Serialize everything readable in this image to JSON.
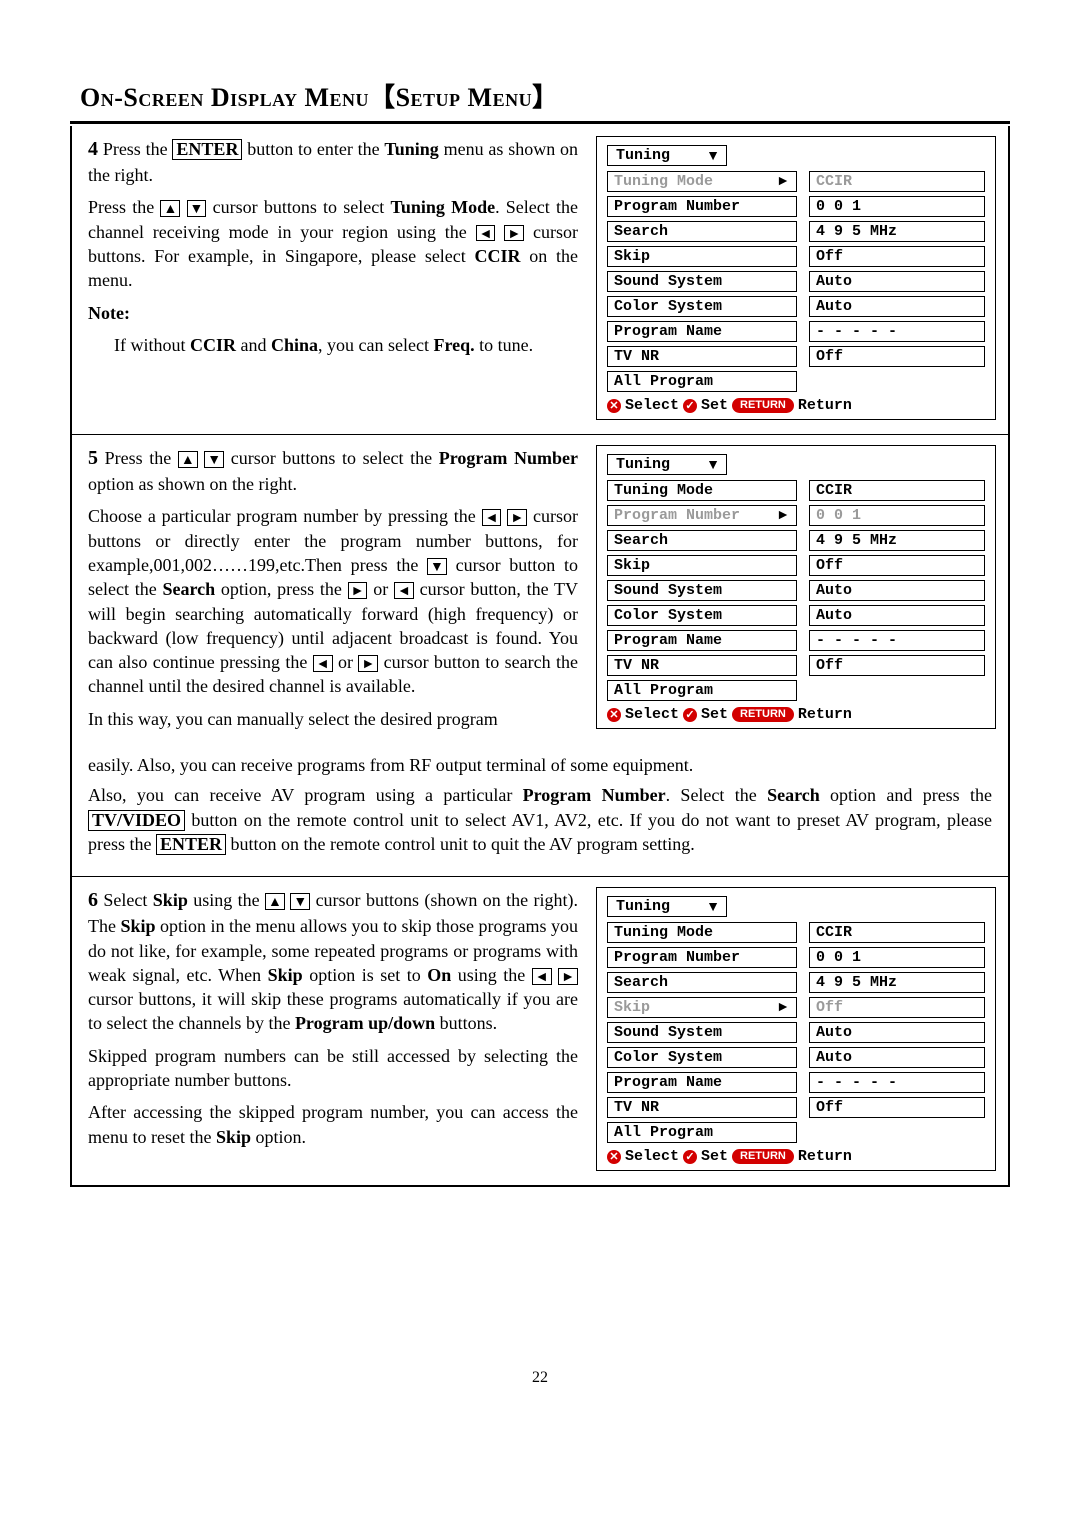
{
  "title": {
    "part1": "On-Screen Display Menu",
    "bracket_open": "【",
    "part2": "Setup Menu",
    "bracket_close": "】"
  },
  "page_number": "22",
  "steps": {
    "s4": {
      "num": "4",
      "p1a": "Press the ",
      "enter": "ENTER",
      "p1b": " button to enter the ",
      "tuning_b": "Tuning",
      "p1c": " menu as shown on the right.",
      "p2a": "Press the ",
      "p2b": " cursor buttons to select ",
      "tm_b": "Tuning Mode",
      "p2c": ". Select the channel receiving mode in your region using the ",
      "p2d": " cursor buttons. For example, in Singapore, please select ",
      "ccir_b": "CCIR",
      "p2e": " on the menu.",
      "note_hd": "Note:",
      "note_a": "If without ",
      "note_ccir": "CCIR",
      "note_b": " and ",
      "note_china": "China",
      "note_c": ", you can select ",
      "note_freq": "Freq.",
      "note_d": " to tune."
    },
    "s5": {
      "num": "5",
      "p1a": "Press the ",
      "p1b": " cursor buttons to select the ",
      "pn_b": "Program Number",
      "p1c": " option as shown on the right.",
      "p2a": "Choose a particular program number by pressing the ",
      "p2b": " cursor buttons or directly enter the program number buttons, for example,001,002……199,etc.Then press the ",
      "p2c": " cursor button to select the ",
      "search_b": "Search",
      "p2d": " option, press the ",
      "p2e": " or ",
      "p2f": " cursor button, the TV will begin searching automatically forward (high frequency) or backward (low frequency) until adjacent broadcast is found. You can also continue pressing the ",
      "p2g": " or ",
      "p2h": " cursor button to search the channel until the desired channel is available.",
      "p3": "In this way, you can manually select the desired program",
      "p4a": "easily. Also, you can receive programs from RF output terminal of some equipment.",
      "p4b": "Also, you can receive AV program using a particular ",
      "p4c": ". Select the ",
      "p4d": " option and press the ",
      "tvvideo": "TV/VIDEO",
      "p4e": " button on the remote control unit to select AV1, AV2, etc. If you do not want to preset AV program, please press the ",
      "p4f": " button on the remote control unit to quit the AV program setting."
    },
    "s6": {
      "num": "6",
      "p1a": "Select ",
      "skip_b": "Skip",
      "p1b": " using the ",
      "p1c": " cursor buttons (shown on the right). The ",
      "p1d": " option in the menu allows you to skip those programs you do not like, for example, some repeated programs or programs with weak signal, etc. When ",
      "p1e": " option is set to ",
      "on_b": "On",
      "p1f": " using the ",
      "p1g": " cursor buttons, it will skip these programs automatically if you are to select the channels by the ",
      "pud_b": "Program up/down",
      "p1h": " buttons.",
      "p2": "Skipped program numbers can be still accessed by selecting the appropriate number buttons.",
      "p3a": "After accessing the skipped program number, you can access the menu to reset the ",
      "p3b": " option."
    }
  },
  "osd_labels": [
    "Tuning Mode",
    "Program Number",
    "Search",
    "Skip",
    "Sound System",
    "Color System",
    "Program Name",
    "TV NR",
    "All Program"
  ],
  "osd_header": "Tuning",
  "osd_legend": {
    "select": "Select",
    "set": "Set",
    "return_pill": "RETURN",
    "return": "Return"
  },
  "osd1": {
    "selected_index": 0,
    "values": [
      "CCIR",
      "0 0 1",
      "4 9 5 MHz",
      "Off",
      "Auto",
      "Auto",
      "- - - - -",
      "Off",
      ""
    ]
  },
  "osd2": {
    "selected_index": 1,
    "values": [
      "CCIR",
      "0 0 1",
      "4 9 5 MHz",
      "Off",
      "Auto",
      "Auto",
      "- - - - -",
      "Off",
      ""
    ]
  },
  "osd3": {
    "selected_index": 3,
    "values": [
      "CCIR",
      "0 0 1",
      "4 9 5 MHz",
      "Off",
      "Auto",
      "Auto",
      "- - - - -",
      "Off",
      ""
    ]
  },
  "sym": {
    "up": "▲",
    "down": "▼",
    "left": "◄",
    "right": "►"
  }
}
